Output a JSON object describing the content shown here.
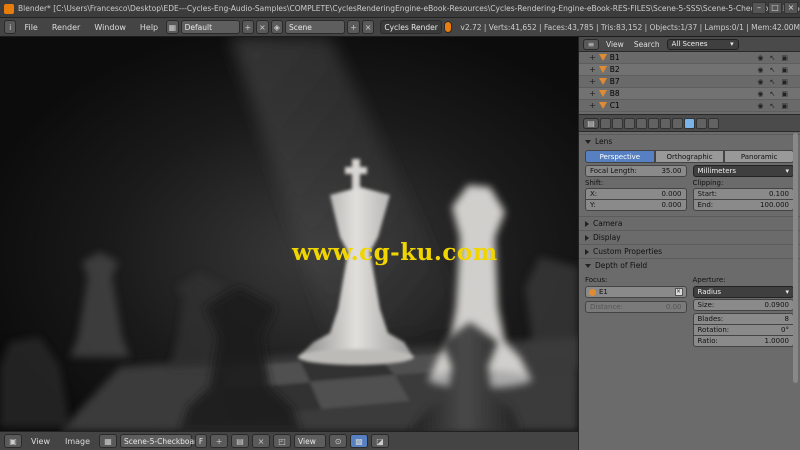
{
  "titlebar": {
    "title": "Blender* [C:\\Users\\Francesco\\Desktop\\EDE---Cycles-Eng-Audio-Samples\\COMPLETE\\CyclesRenderingEngine-eBook-Resources\\Cycles-Rendering-Engine-eBook-RES-FILES\\Scene-5-SSS\\Scene-5-Checkboard.blend]"
  },
  "infobar": {
    "menus": [
      "File",
      "Render",
      "Window",
      "Help"
    ],
    "screen_layout": "Default",
    "scene": "Scene",
    "render_engine": "Cycles Render",
    "stats": "v2.72 | Verts:41,652 | Faces:43,785 | Tris:83,152 | Objects:1/37 | Lamps:0/1 | Mem:42.00M"
  },
  "viewport": {
    "watermark": "www.cg-ku.com"
  },
  "image_header": {
    "view": "View",
    "image": "Image",
    "image_name": "Scene-5-Checkboar...",
    "f": "F",
    "view2": "View"
  },
  "outliner": {
    "view": "View",
    "search": "Search",
    "filter": "All Scenes",
    "items": [
      "B1",
      "B2",
      "B7",
      "B8",
      "C1"
    ]
  },
  "properties": {
    "lens": {
      "header": "Lens",
      "tabs": [
        "Perspective",
        "Orthographic",
        "Panoramic"
      ],
      "focal_label": "Focal Length:",
      "focal_value": "35.00",
      "units": "Millimeters",
      "shift_label": "Shift:",
      "shift_x_label": "X:",
      "shift_x": "0.000",
      "shift_y_label": "Y:",
      "shift_y": "0.000",
      "clipping_label": "Clipping:",
      "start_label": "Start:",
      "start": "0.100",
      "end_label": "End:",
      "end": "100.000"
    },
    "collapsed_panels": [
      "Camera",
      "Display",
      "Custom Properties"
    ],
    "dof": {
      "header": "Depth of Field",
      "focus_label": "Focus:",
      "focus_object": "E1",
      "distance_label": "Distance:",
      "distance": "0.00",
      "aperture_label": "Aperture:",
      "aperture_type": "Radius",
      "size_label": "Size:",
      "size": "0.0900",
      "blades_label": "Blades:",
      "blades": "8",
      "rotation_label": "Rotation:",
      "rotation": "0°",
      "ratio_label": "Ratio:",
      "ratio": "1.0000"
    }
  }
}
